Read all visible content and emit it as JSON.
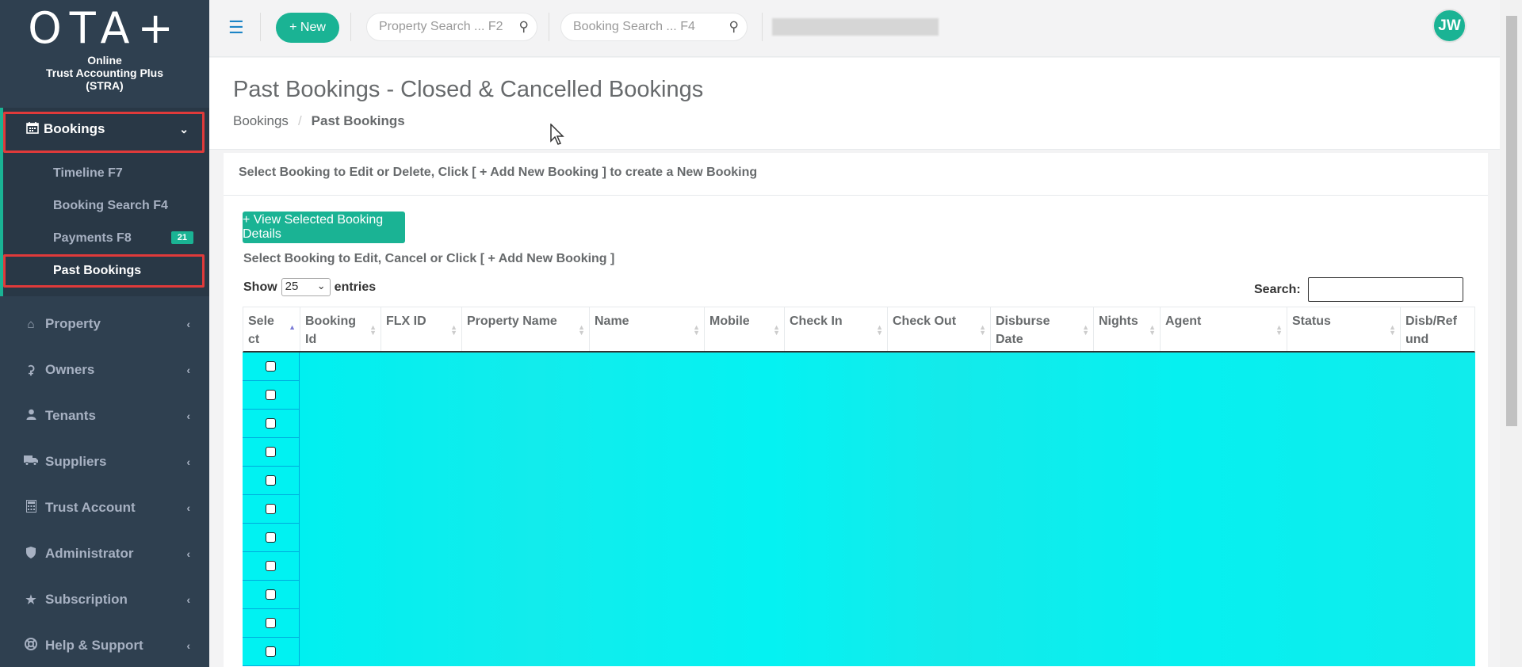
{
  "app": {
    "logo": "OTA+",
    "subtitle_lines": [
      "Online",
      "Trust Accounting Plus",
      "(STRA)"
    ]
  },
  "sidebar": {
    "bookings": {
      "label": "Bookings",
      "icon": "calendar-icon",
      "items": [
        {
          "label": "Timeline F7"
        },
        {
          "label": "Booking Search F4"
        },
        {
          "label": "Payments F8",
          "badge": "21"
        },
        {
          "label": "Past Bookings",
          "active": true
        }
      ]
    },
    "items": [
      {
        "label": "Property",
        "icon": "home-icon"
      },
      {
        "label": "Owners",
        "icon": "key-icon"
      },
      {
        "label": "Tenants",
        "icon": "user-icon"
      },
      {
        "label": "Suppliers",
        "icon": "truck-icon"
      },
      {
        "label": "Trust Account",
        "icon": "calculator-icon"
      },
      {
        "label": "Administrator",
        "icon": "shield-icon"
      },
      {
        "label": "Subscription",
        "icon": "star-icon"
      },
      {
        "label": "Help & Support",
        "icon": "lifebuoy-icon"
      }
    ]
  },
  "topbar": {
    "new_label": "+ New",
    "property_search_placeholder": "Property Search ... F2",
    "booking_search_placeholder": "Booking Search ... F4",
    "avatar_initials": "JW"
  },
  "page": {
    "title": "Past Bookings - Closed & Cancelled Bookings",
    "breadcrumb": [
      "Bookings",
      "Past Bookings"
    ]
  },
  "panel": {
    "title": "Select Booking to Edit or Delete, Click [ + Add New Booking ] to create a New Booking",
    "view_button": "+ View Selected Booking Details",
    "instruction": "Select Booking to Edit, Cancel or Click [ + Add New Booking ]",
    "show_label": "Show",
    "entries_value": "25",
    "entries_label": "entries",
    "search_label": "Search:"
  },
  "table": {
    "columns": [
      {
        "line1": "Sele",
        "line2": "ct"
      },
      {
        "line1": "Booking",
        "line2": "Id"
      },
      {
        "line1": "FLX ID",
        "line2": ""
      },
      {
        "line1": "Property Name",
        "line2": ""
      },
      {
        "line1": "Name",
        "line2": ""
      },
      {
        "line1": "Mobile",
        "line2": ""
      },
      {
        "line1": "Check In",
        "line2": ""
      },
      {
        "line1": "Check Out",
        "line2": ""
      },
      {
        "line1": "Disburse",
        "line2": "Date"
      },
      {
        "line1": "Nights",
        "line2": ""
      },
      {
        "line1": "Agent",
        "line2": ""
      },
      {
        "line1": "Status",
        "line2": ""
      },
      {
        "line1": "Disb/Ref",
        "line2": "und"
      }
    ],
    "visible_rows": 11
  },
  "colors": {
    "sidebar_bg": "#2f4050",
    "accent": "#1ab394",
    "highlight_rows": "#00f2f2",
    "annotation_red": "#e03a3a"
  }
}
